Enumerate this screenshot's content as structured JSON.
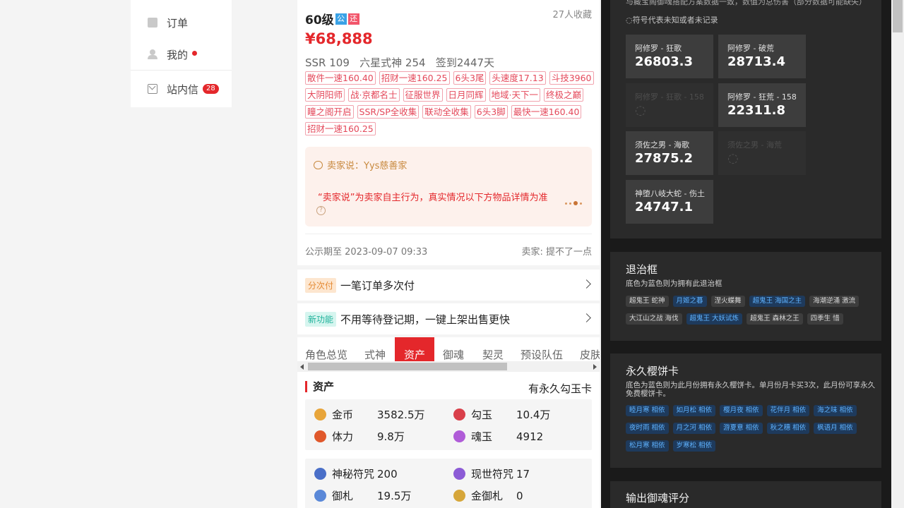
{
  "nav": {
    "items": [
      {
        "label": "订单",
        "icon": "order-icon"
      },
      {
        "label": "我的",
        "icon": "user-icon"
      },
      {
        "label": "站内信",
        "icon": "mail-icon",
        "count": "28"
      }
    ]
  },
  "product": {
    "level": "60级",
    "tag_public": "公",
    "tag_return": "还",
    "favorites": "27人收藏",
    "price": "¥68,888",
    "stats": "SSR 109   六星式神 254   签到2447天",
    "chips": [
      "散件一速160.40",
      "招财一速160.25",
      "6头3尾",
      "头速度17.13",
      "斗技3960",
      "大阴阳师",
      "战·京都名士",
      "征服世界",
      "日月同辉",
      "地域·天下一",
      "终极之巅",
      "瞳之阁开启",
      "SSR/SP全收集",
      "联动全收集",
      "6头3脚",
      "最快一速160.40",
      "招财一速160.25"
    ],
    "seller_say": "卖家说：Yys慈善家",
    "seller_note": "“卖家说”为卖家自主行为，真实情况以下方物品详情为准",
    "help_mark": "?",
    "public_until": "公示期至 2023-09-07 09:33",
    "seller": "卖家: 提不了一点"
  },
  "bars": [
    {
      "tag": "分次付",
      "text": "一笔订单多次付"
    },
    {
      "tag": "新功能",
      "text": "不用等待登记期，一键上架出售更快"
    }
  ],
  "tabs": [
    "角色总览",
    "式神",
    "资产",
    "御魂",
    "契灵",
    "预设队伍",
    "皮肤"
  ],
  "assets": {
    "title": "资产",
    "right_note": "有永久勾玉卡",
    "row1": [
      {
        "name": "金币",
        "value": "3582.5万",
        "icon": "coin-icon",
        "color": "#e8a53a"
      },
      {
        "name": "勾玉",
        "value": "10.4万",
        "icon": "jade-icon",
        "color": "#d9404a"
      },
      {
        "name": "体力",
        "value": "9.8万",
        "icon": "stamina-icon",
        "color": "#e0582b"
      },
      {
        "name": "魂玉",
        "value": "4912",
        "icon": "soul-jade-icon",
        "color": "#b05cd8"
      }
    ],
    "row2": [
      {
        "name": "神秘符咒",
        "value": "200",
        "icon": "mystery-charm-icon",
        "color": "#4a6fc8"
      },
      {
        "name": "现世符咒",
        "value": "17",
        "icon": "present-charm-icon",
        "color": "#8c5bd6"
      },
      {
        "name": "御札",
        "value": "19.5万",
        "icon": "amulet-icon",
        "color": "#5a88d8"
      },
      {
        "name": "金御札",
        "value": "0",
        "icon": "gold-amulet-icon",
        "color": "#d6a63a"
      }
    ]
  },
  "right": {
    "note_top": "与藏宝阁御魂搭配方案数据一致，数值为总伤害（部分数据可能缺失）",
    "note_symbol": "◌符号代表未知或者未记录",
    "souls": [
      {
        "name": "阿修罗 - 狂歌",
        "value": "26803.3",
        "dim": false
      },
      {
        "name": "阿修罗 - 破荒",
        "value": "28713.4",
        "dim": false
      },
      {
        "name": "阿修罗 - 狂歌 - 158",
        "value": "◌",
        "dim": true
      },
      {
        "name": "阿修罗 - 狂荒 - 158",
        "value": "22311.8",
        "dim": false
      },
      {
        "name": "须佐之男 - 海歌",
        "value": "27875.2",
        "dim": false
      },
      {
        "name": "须佐之男 - 海荒",
        "value": "◌",
        "dim": true
      },
      {
        "name": "神堕八岐大蛇 - 伤土",
        "value": "24747.1",
        "dim": false
      }
    ],
    "panel_retreat": {
      "title": "退治框",
      "desc": "底色为蓝色则为拥有此退治框",
      "chips": [
        {
          "label": "超鬼王 蛇神",
          "owned": false
        },
        {
          "label": "月姬之暮",
          "owned": true
        },
        {
          "label": "涅火蝶舞",
          "owned": false
        },
        {
          "label": "超鬼王 海国之主",
          "owned": true
        },
        {
          "label": "海潮逆涌 激流",
          "owned": false
        },
        {
          "label": "大江山之战 海伐",
          "owned": false
        },
        {
          "label": "超鬼王 大妖试炼",
          "owned": true
        },
        {
          "label": "超鬼王 森林之王",
          "owned": false
        },
        {
          "label": "四季生 惜",
          "owned": false
        }
      ]
    },
    "panel_sakura": {
      "title": "永久樱饼卡",
      "desc": "底色为蓝色则为此月份拥有永久樱饼卡。单月份月卡买3次，此月份可享永久免费樱饼卡。",
      "chips": [
        "睦月寒 相依",
        "如月松 相依",
        "樱月夜 相依",
        "花伴月 相依",
        "海之味 相依",
        "夜时雨 相依",
        "月之河 相依",
        "游夏意 相依",
        "秋之穗 相依",
        "枫语月 相依",
        "松月寒 相依",
        "岁寒松 相依"
      ]
    },
    "panel_output_title": "输出御魂评分"
  }
}
